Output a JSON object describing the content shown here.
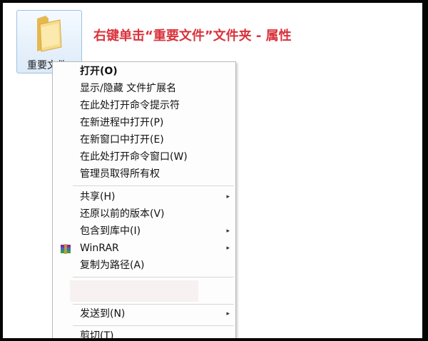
{
  "folder": {
    "label": "重要文件",
    "icon": "folder-icon"
  },
  "headline": "右键单击“重要文件”文件夹 - 属性",
  "menu": {
    "items": [
      {
        "label": "打开(O)"
      },
      {
        "label": "显示/隐藏 文件扩展名"
      },
      {
        "label": "在此处打开命令提示符"
      },
      {
        "label": "在新进程中打开(P)"
      },
      {
        "label": "在新窗口中打开(E)"
      },
      {
        "label": "在此处打开命令窗口(W)"
      },
      {
        "label": "管理员取得所有权"
      },
      {
        "label": "共享(H)"
      },
      {
        "label": "还原以前的版本(V)"
      },
      {
        "label": "包含到库中(I)"
      },
      {
        "label": "WinRAR",
        "icon": "winrar-icon"
      },
      {
        "label": "复制为路径(A)"
      },
      {
        "label": "发送到(N)"
      },
      {
        "label": "剪切(T)"
      }
    ],
    "submenu_arrow": "▸"
  },
  "colors": {
    "headline": "#d9323b",
    "folder_highlight": "#dceaf8"
  }
}
